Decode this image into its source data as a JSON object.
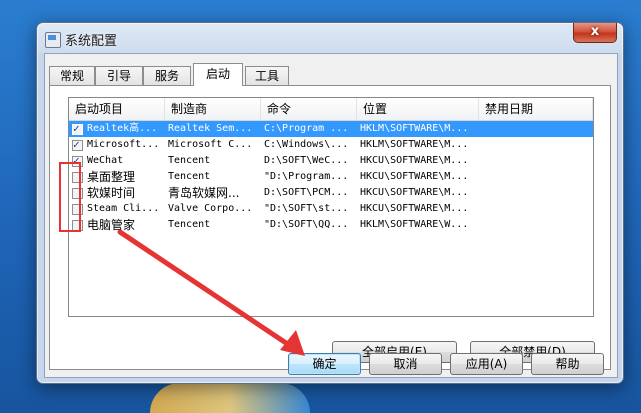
{
  "window": {
    "title": "系统配置",
    "close_glyph": "x"
  },
  "tabs": [
    {
      "label": "常规",
      "active": false
    },
    {
      "label": "引导",
      "active": false
    },
    {
      "label": "服务",
      "active": false
    },
    {
      "label": "启动",
      "active": true
    },
    {
      "label": "工具",
      "active": false
    }
  ],
  "startup_list": {
    "columns": [
      "启动项目",
      "制造商",
      "命令",
      "位置",
      "禁用日期"
    ],
    "rows": [
      {
        "name": "Realtek高...",
        "maker": "Realtek Sem...",
        "command": "C:\\Program ...",
        "location": "HKLM\\SOFTWARE\\M...",
        "disabled_date": "",
        "checked": true,
        "selected": true
      },
      {
        "name": "Microsoft...",
        "maker": "Microsoft C...",
        "command": "C:\\Windows\\...",
        "location": "HKLM\\SOFTWARE\\M...",
        "disabled_date": "",
        "checked": true,
        "selected": false
      },
      {
        "name": "WeChat",
        "maker": "Tencent",
        "command": "D:\\SOFT\\WeC...",
        "location": "HKCU\\SOFTWARE\\M...",
        "disabled_date": "",
        "checked": true,
        "selected": false
      },
      {
        "name": "桌面整理",
        "maker": "Tencent",
        "command": "\"D:\\Program...",
        "location": "HKCU\\SOFTWARE\\M...",
        "disabled_date": "",
        "checked": false,
        "selected": false
      },
      {
        "name": "软媒时间",
        "maker": "青岛软媒网...",
        "command": "D:\\SOFT\\PCM...",
        "location": "HKCU\\SOFTWARE\\M...",
        "disabled_date": "",
        "checked": false,
        "selected": false
      },
      {
        "name": "Steam Cli...",
        "maker": "Valve Corpo...",
        "command": "\"D:\\SOFT\\st...",
        "location": "HKCU\\SOFTWARE\\M...",
        "disabled_date": "",
        "checked": false,
        "selected": false
      },
      {
        "name": "电脑管家",
        "maker": "Tencent",
        "command": "\"D:\\SOFT\\QQ...",
        "location": "HKLM\\SOFTWARE\\W...",
        "disabled_date": "",
        "checked": false,
        "selected": false
      }
    ]
  },
  "panel_buttons": {
    "enable_all": "全部启用(E)",
    "disable_all": "全部禁用(D)"
  },
  "dialog_buttons": {
    "ok": "确定",
    "cancel": "取消",
    "apply": "应用(A)",
    "help": "帮助"
  },
  "colors": {
    "annotation": "#e63434",
    "selection": "#3399ff"
  },
  "icons": {
    "app": "system-config-icon",
    "close": "close-icon",
    "arrow": "annotation-arrow"
  }
}
